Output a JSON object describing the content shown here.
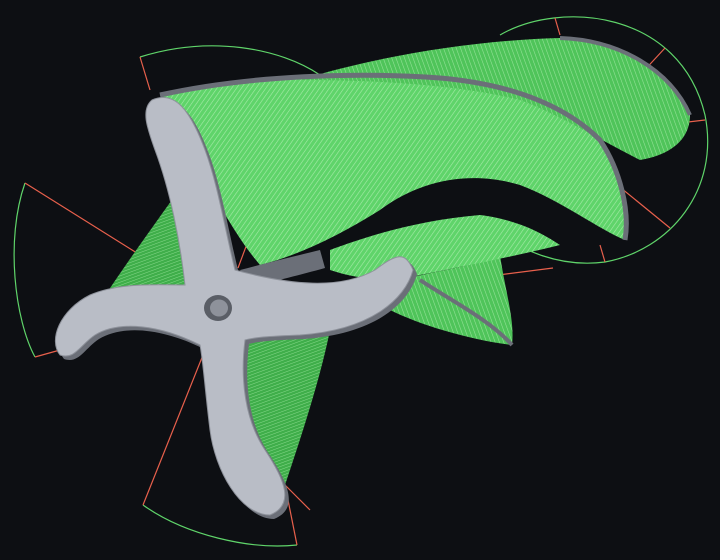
{
  "scene": {
    "background_color": "#0d0f13",
    "surface_color": "#5fd46a",
    "surface_highlight_color": "#9ee6a2",
    "surface_shadow_color": "#2f8a3a",
    "hub_color": "#b9bdc6",
    "hub_edge_color": "#6b6f78",
    "guide_arc_color": "#5fd46a",
    "guide_line_color": "#e8604c"
  }
}
